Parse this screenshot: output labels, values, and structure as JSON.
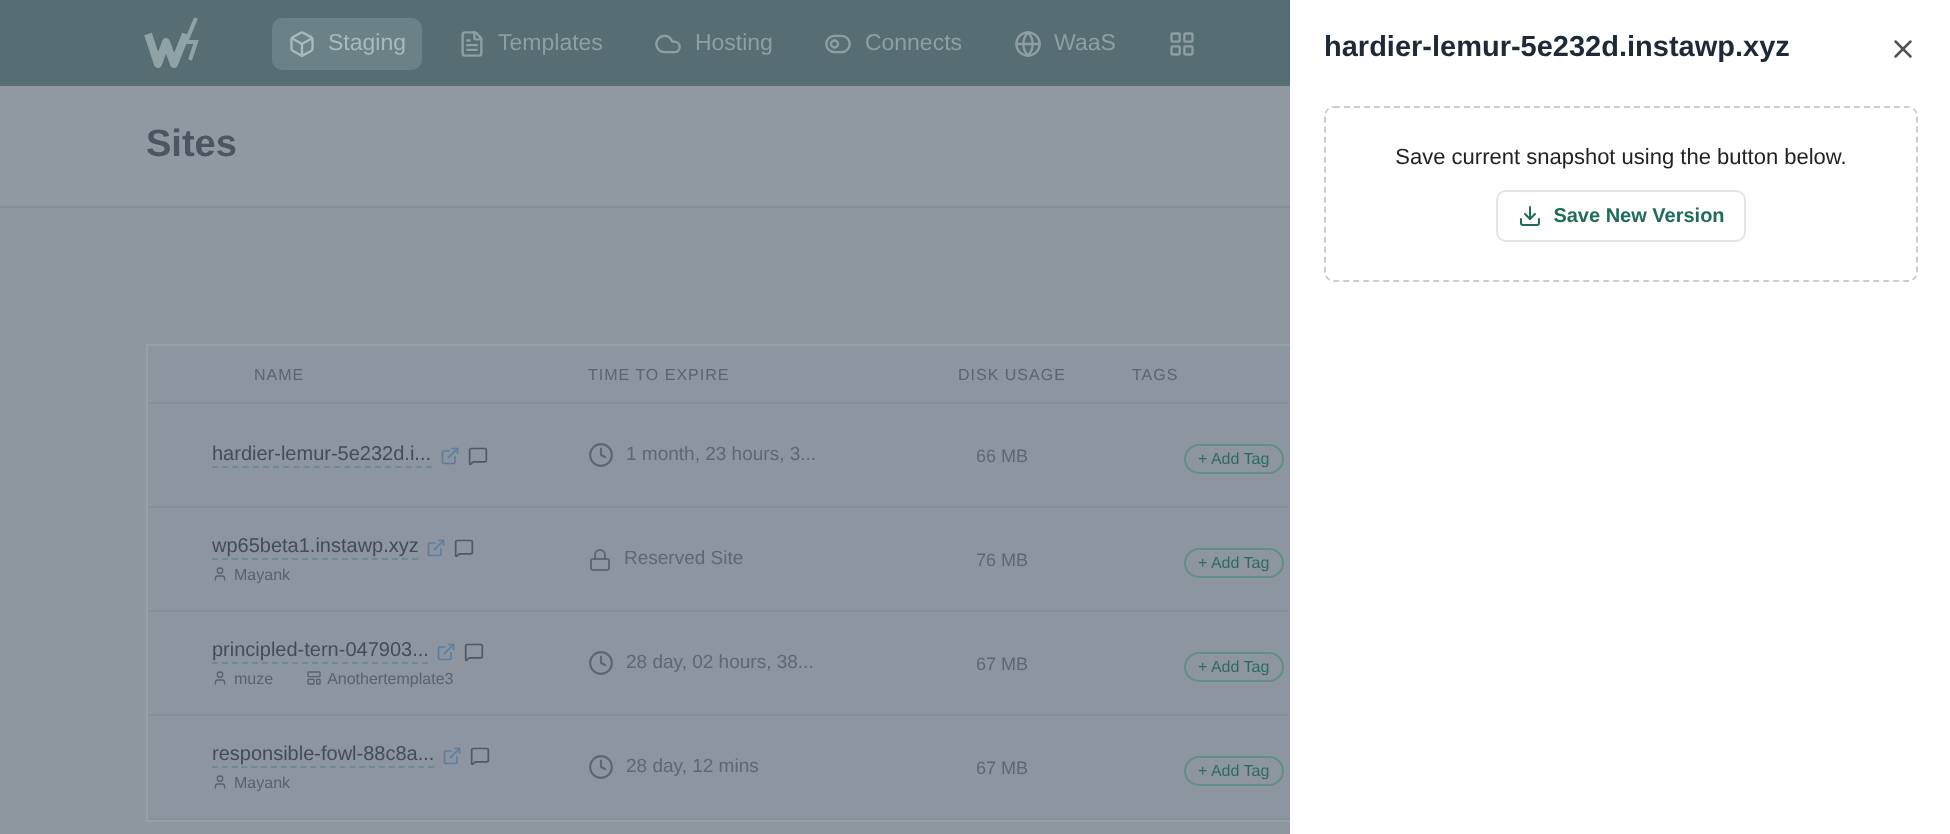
{
  "nav": {
    "items": [
      {
        "label": "Staging",
        "selected": true
      },
      {
        "label": "Templates",
        "selected": false
      },
      {
        "label": "Hosting",
        "selected": false
      },
      {
        "label": "Connects",
        "selected": false
      },
      {
        "label": "WaaS",
        "selected": false
      },
      {
        "selected": false
      }
    ]
  },
  "page": {
    "title": "Sites"
  },
  "table": {
    "columns": [
      "NAME",
      "TIME TO EXPIRE",
      "DISK USAGE",
      "TAGS"
    ],
    "rows": [
      {
        "name": "hardier-lemur-5e232d.i...",
        "kind": "timer",
        "expire": "1 month, 23 hours, 3...",
        "disk": "66 MB",
        "tag_button": "+ Add Tag"
      },
      {
        "name": "wp65beta1.instawp.xyz",
        "owner": "Mayank",
        "kind": "reserved",
        "expire": "Reserved Site",
        "disk": "76 MB",
        "tag_button": "+ Add Tag"
      },
      {
        "name": "principled-tern-047903...",
        "owner": "muze",
        "template": "Anothertemplate3",
        "kind": "timer",
        "expire": "28 day, 02 hours, 38...",
        "disk": "67 MB",
        "tag_button": "+ Add Tag"
      },
      {
        "name": "responsible-fowl-88c8a...",
        "owner": "Mayank",
        "kind": "timer",
        "expire": "28 day, 12 mins",
        "disk": "67 MB",
        "tag_button": "+ Add Tag"
      }
    ]
  },
  "drawer": {
    "title": "hardier-lemur-5e232d.instawp.xyz",
    "message": "Save current snapshot using the button below.",
    "button": "Save New Version"
  }
}
